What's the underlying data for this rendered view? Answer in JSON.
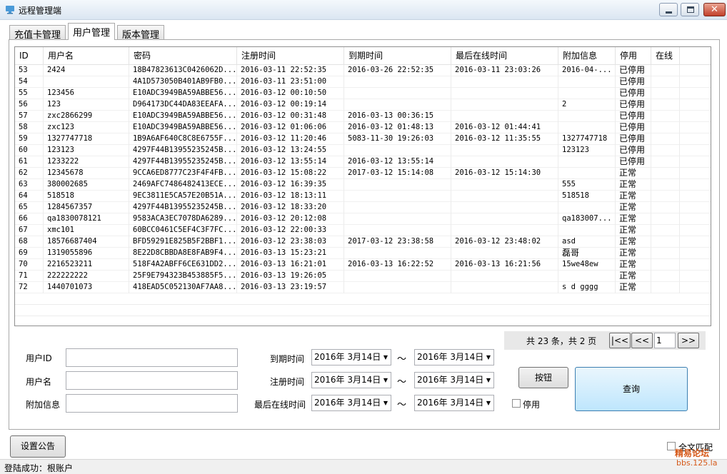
{
  "window": {
    "title": "远程管理端",
    "minimize_glyph": "",
    "close_glyph": "✕",
    "icon": "app-icon"
  },
  "tabs": [
    {
      "label": "充值卡管理",
      "active": false
    },
    {
      "label": "用户管理",
      "active": true
    },
    {
      "label": "版本管理",
      "active": false
    }
  ],
  "grid": {
    "columns": [
      "ID",
      "用户名",
      "密码",
      "注册时间",
      "到期时间",
      "最后在线时间",
      "附加信息",
      "停用",
      "在线"
    ],
    "rows": [
      [
        "53",
        "2424",
        "18B47823613C0426062D...",
        "2016-03-11 22:52:35",
        "2016-03-26 22:52:35",
        "2016-03-11 23:03:26",
        "2016-04-...",
        "已停用",
        ""
      ],
      [
        "54",
        "",
        "4A1D573050B401AB9FB0...",
        "2016-03-11 23:51:00",
        "",
        "",
        "",
        "已停用",
        ""
      ],
      [
        "55",
        "123456",
        "E10ADC3949BA59ABBE56...",
        "2016-03-12 00:10:50",
        "",
        "",
        "",
        "已停用",
        ""
      ],
      [
        "56",
        "123",
        "D964173DC44DA83EEAFA...",
        "2016-03-12 00:19:14",
        "",
        "",
        "2",
        "已停用",
        ""
      ],
      [
        "57",
        "zxc2866299",
        "E10ADC3949BA59ABBE56...",
        "2016-03-12 00:31:48",
        "2016-03-13 00:36:15",
        "",
        "",
        "已停用",
        ""
      ],
      [
        "58",
        "zxc123",
        "E10ADC3949BA59ABBE56...",
        "2016-03-12 01:06:06",
        "2016-03-12 01:48:13",
        "2016-03-12 01:44:41",
        "",
        "已停用",
        ""
      ],
      [
        "59",
        "1327747718",
        "1B9A6AF640C8C8E6755F...",
        "2016-03-12 11:20:46",
        "5083-11-30 19:26:03",
        "2016-03-12 11:35:55",
        "1327747718",
        "已停用",
        ""
      ],
      [
        "60",
        "123123",
        "4297F44B13955235245B...",
        "2016-03-12 13:24:55",
        "",
        "",
        "123123",
        "已停用",
        ""
      ],
      [
        "61",
        "1233222",
        "4297F44B13955235245B...",
        "2016-03-12 13:55:14",
        "2016-03-12 13:55:14",
        "",
        "",
        "已停用",
        ""
      ],
      [
        "62",
        "12345678",
        "9CCA6ED8777C23F4F4FB...",
        "2016-03-12 15:08:22",
        "2017-03-12 15:14:08",
        "2016-03-12 15:14:30",
        "",
        "正常",
        ""
      ],
      [
        "63",
        "380002685",
        "2469AFC7486482413ECE...",
        "2016-03-12 16:39:35",
        "",
        "",
        "555",
        "正常",
        ""
      ],
      [
        "64",
        "518518",
        "9EC3811E5CA57E20B51A...",
        "2016-03-12 18:13:11",
        "",
        "",
        "518518",
        "正常",
        ""
      ],
      [
        "65",
        "1284567357",
        "4297F44B13955235245B...",
        "2016-03-12 18:33:20",
        "",
        "",
        "",
        "正常",
        ""
      ],
      [
        "66",
        "qa1830078121",
        "9583ACA3EC7078DA6289...",
        "2016-03-12 20:12:08",
        "",
        "",
        "qa183007...",
        "正常",
        ""
      ],
      [
        "67",
        "xmc101",
        "60BCC0461C5EF4C3F7FC...",
        "2016-03-12 22:00:33",
        "",
        "",
        "",
        "正常",
        ""
      ],
      [
        "68",
        "18576687404",
        "BFD59291E825B5F2BBF1...",
        "2016-03-12 23:38:03",
        "2017-03-12 23:38:58",
        "2016-03-12 23:48:02",
        "asd",
        "正常",
        ""
      ],
      [
        "69",
        "1319055896",
        "8E22D8CBBDA8E8FAB9F4...",
        "2016-03-13 15:23:21",
        "",
        "",
        "磊哥",
        "正常",
        ""
      ],
      [
        "70",
        "2216523211",
        "518F4A2ABFF6CE631DD2...",
        "2016-03-13 16:21:01",
        "2016-03-13 16:22:52",
        "2016-03-13 16:21:56",
        "15we48ew",
        "正常",
        ""
      ],
      [
        "71",
        "222222222",
        "25F9E794323B453885F5...",
        "2016-03-13 19:26:05",
        "",
        "",
        "",
        "正常",
        ""
      ],
      [
        "72",
        "1440701073",
        "418EAD5C052130AF7AA8...",
        "2016-03-13 23:19:57",
        "",
        "",
        "s  d  gggg",
        "正常",
        ""
      ]
    ]
  },
  "pager": {
    "info": "共 23 条，共 2 页",
    "first": "|<<",
    "prev": "<<",
    "page": "1",
    "next": ">>"
  },
  "filters": {
    "user_id_label": "用户ID",
    "username_label": "用户名",
    "extra_label": "附加信息",
    "expire_label": "到期时间",
    "register_label": "注册时间",
    "last_online_label": "最后在线时间",
    "tilde": "～",
    "date_value": "2016年 3月14日",
    "disabled_label": "停用"
  },
  "buttons": {
    "generic": "按钮",
    "query": "查询",
    "announce": "设置公告"
  },
  "fulltext_label": "全文匹配",
  "status": "登陆成功：根账户",
  "watermark": {
    "line1": "精易论坛",
    "line2": "bbs.125.la"
  }
}
